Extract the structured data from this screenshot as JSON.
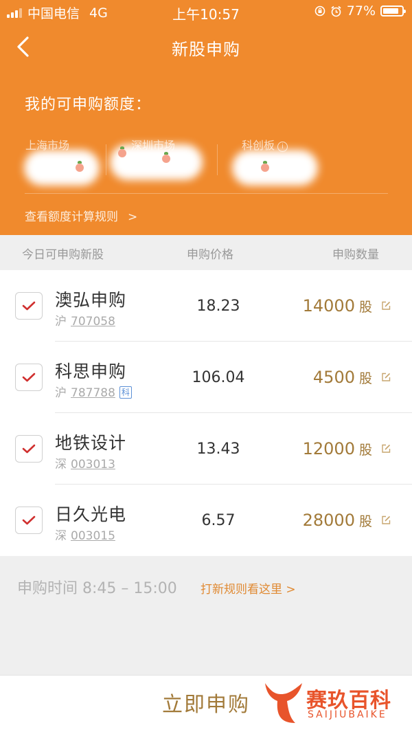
{
  "status_bar": {
    "carrier": "中国电信",
    "network": "4G",
    "time": "上午10:57",
    "battery": "77%"
  },
  "nav": {
    "title": "新股申购"
  },
  "quota": {
    "title": "我的可申购额度：",
    "markets": [
      {
        "label": "上海市场"
      },
      {
        "label": "深圳市场"
      },
      {
        "label": "科创板"
      }
    ],
    "rule_link": "查看额度计算规则"
  },
  "table": {
    "headers": [
      "今日可申购新股",
      "申购价格",
      "申购数量"
    ],
    "rows": [
      {
        "name": "澳弘申购",
        "market": "沪",
        "code": "707058",
        "badge": "",
        "price": "18.23",
        "qty": "14000",
        "unit": "股"
      },
      {
        "name": "科思申购",
        "market": "沪",
        "code": "787788",
        "badge": "科",
        "price": "106.04",
        "qty": "4500",
        "unit": "股"
      },
      {
        "name": "地铁设计",
        "market": "深",
        "code": "003013",
        "badge": "",
        "price": "13.43",
        "qty": "12000",
        "unit": "股"
      },
      {
        "name": "日久光电",
        "market": "深",
        "code": "003015",
        "badge": "",
        "price": "6.57",
        "qty": "28000",
        "unit": "股"
      }
    ]
  },
  "footer": {
    "time_label": "申购时间 8:45 – 15:00",
    "rule_link": "打新规则看这里 >",
    "apply_button": "立即申购"
  },
  "watermark": {
    "name": "赛玖百科",
    "pinyin": "SAIJIUBAIKE"
  },
  "colors": {
    "header_bg": "#f08a2d",
    "accent_gold": "#a27a39",
    "check_red": "#d0302f",
    "link_orange": "#e08a33"
  }
}
